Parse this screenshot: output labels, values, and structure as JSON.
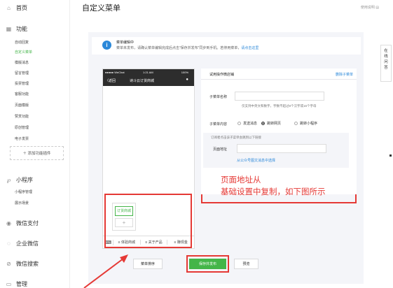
{
  "sidebar": {
    "home": "首页",
    "features": "功能",
    "feature_items": [
      "自动回复",
      "自定义菜单",
      "模版消息",
      "留言管理",
      "投票管理",
      "客服功能",
      "页面模版",
      "赞赏功能",
      "原创管理",
      "电子发票"
    ],
    "add_plugin": "＋ 添加功能插件",
    "mini_program": "小程序",
    "mini_items": [
      "小程序管理",
      "展示场景"
    ],
    "pay": "微信支付",
    "enterprise": "企业微信",
    "search": "微信搜索",
    "manage": "管理"
  },
  "header": {
    "title": "自定义菜单",
    "help": "使用说明"
  },
  "notice": {
    "title": "菜单编辑中",
    "text": "菜单未发布，请确认菜单编辑完成后点击“保存并发布”同步到手机。若停用菜单，",
    "link": "请点击这里"
  },
  "phone": {
    "carrier": "●●●●● WeChat",
    "time": "1:21 AM",
    "battery": "100%",
    "back": "返回",
    "account": "诗斗云订货商城",
    "submenu_item": "订货商城",
    "menus": [
      "体验商城",
      "关于产品",
      "赚现金"
    ]
  },
  "editor": {
    "title": "试用操作微店铺",
    "delete": "删除子菜单",
    "name_label": "子菜单名称",
    "name_hint": "仅支持中英文和数字，字数不超过8个汉字或16个字母",
    "content_label": "子菜单内容",
    "options": [
      "发送消息",
      "跳转网页",
      "跳转小程序"
    ],
    "selected_option": "跳转网页",
    "url_desc": "订阅者点击该子菜单会跳到以下链接",
    "url_label": "页面地址",
    "url_link": "从公众号图文消息中选择"
  },
  "annotation": {
    "line1": "页面地址从",
    "line2": "基础设置中复制，如下图所示"
  },
  "buttons": {
    "sort": "菜单排序",
    "save": "保存并发布",
    "preview": "预览"
  },
  "right_panel": {
    "text": "在线问答"
  },
  "colors": {
    "accent_green": "#44b549",
    "link_blue": "#2b88d9",
    "annotation_red": "#e53935"
  }
}
